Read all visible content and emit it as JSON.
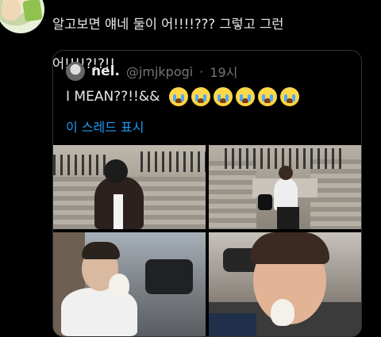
{
  "tweet": {
    "text_line1": "알고보면 얘네 둘이 어!!!!??? 그렇고 그런",
    "text_line2": "어!!!!?!?!!"
  },
  "quote": {
    "name": "nel.",
    "handle": "@jmjkpogi",
    "dot": "·",
    "time": "19시",
    "text": "I MEAN??!!&&",
    "emoji_count": 6,
    "thread_link": "이 스레드 표시"
  },
  "icons": {
    "author_avatar": "profile-photo",
    "quote_avatar": "profile-photo",
    "emoji": "loudly-crying-face-emoji"
  },
  "colors": {
    "background": "#000000",
    "text": "#e7e9ea",
    "muted": "#71767b",
    "link": "#1d9bf0",
    "border": "#2f3336"
  }
}
